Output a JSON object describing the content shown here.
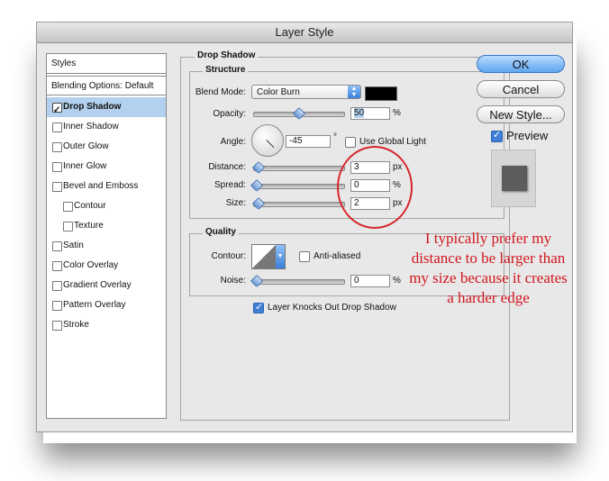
{
  "window": {
    "title": "Layer Style"
  },
  "styles_panel": {
    "header": "Styles",
    "blending": "Blending Options: Default",
    "items": [
      {
        "label": "Drop Shadow",
        "checked": true,
        "selected": true,
        "sub": false
      },
      {
        "label": "Inner Shadow",
        "checked": false,
        "selected": false,
        "sub": false
      },
      {
        "label": "Outer Glow",
        "checked": false,
        "selected": false,
        "sub": false
      },
      {
        "label": "Inner Glow",
        "checked": false,
        "selected": false,
        "sub": false
      },
      {
        "label": "Bevel and Emboss",
        "checked": false,
        "selected": false,
        "sub": false
      },
      {
        "label": "Contour",
        "checked": false,
        "selected": false,
        "sub": true
      },
      {
        "label": "Texture",
        "checked": false,
        "selected": false,
        "sub": true
      },
      {
        "label": "Satin",
        "checked": false,
        "selected": false,
        "sub": false
      },
      {
        "label": "Color Overlay",
        "checked": false,
        "selected": false,
        "sub": false
      },
      {
        "label": "Gradient Overlay",
        "checked": false,
        "selected": false,
        "sub": false
      },
      {
        "label": "Pattern Overlay",
        "checked": false,
        "selected": false,
        "sub": false
      },
      {
        "label": "Stroke",
        "checked": false,
        "selected": false,
        "sub": false
      }
    ]
  },
  "drop_shadow": {
    "title": "Drop Shadow",
    "structure": {
      "title": "Structure",
      "blend_mode_label": "Blend Mode:",
      "blend_mode_value": "Color Burn",
      "swatch_color": "#000000",
      "opacity_label": "Opacity:",
      "opacity_value": "50",
      "opacity_level": 50,
      "percent": "%",
      "angle_label": "Angle:",
      "angle_value": "-45",
      "degree": "°",
      "use_global_light_label": "Use Global Light",
      "use_global_light": false,
      "distance_label": "Distance:",
      "distance_value": "3",
      "px": "px",
      "spread_label": "Spread:",
      "spread_value": "0",
      "size_label": "Size:",
      "size_value": "2"
    },
    "quality": {
      "title": "Quality",
      "contour_label": "Contour:",
      "anti_aliased_label": "Anti-aliased",
      "anti_aliased": false,
      "noise_label": "Noise:",
      "noise_value": "0",
      "percent": "%"
    },
    "knockout_label": "Layer Knocks Out Drop Shadow",
    "knockout": true
  },
  "buttons": {
    "ok": "OK",
    "cancel": "Cancel",
    "new_style": "New Style...",
    "preview_label": "Preview",
    "preview_checked": true
  },
  "annotation": "I typically prefer my distance to be larger than my size because it creates a harder edge",
  "colors": {
    "accent_blue": "#5ea6ef",
    "annotation_red": "#d2161d",
    "selected_row": "#b3d0ee"
  }
}
